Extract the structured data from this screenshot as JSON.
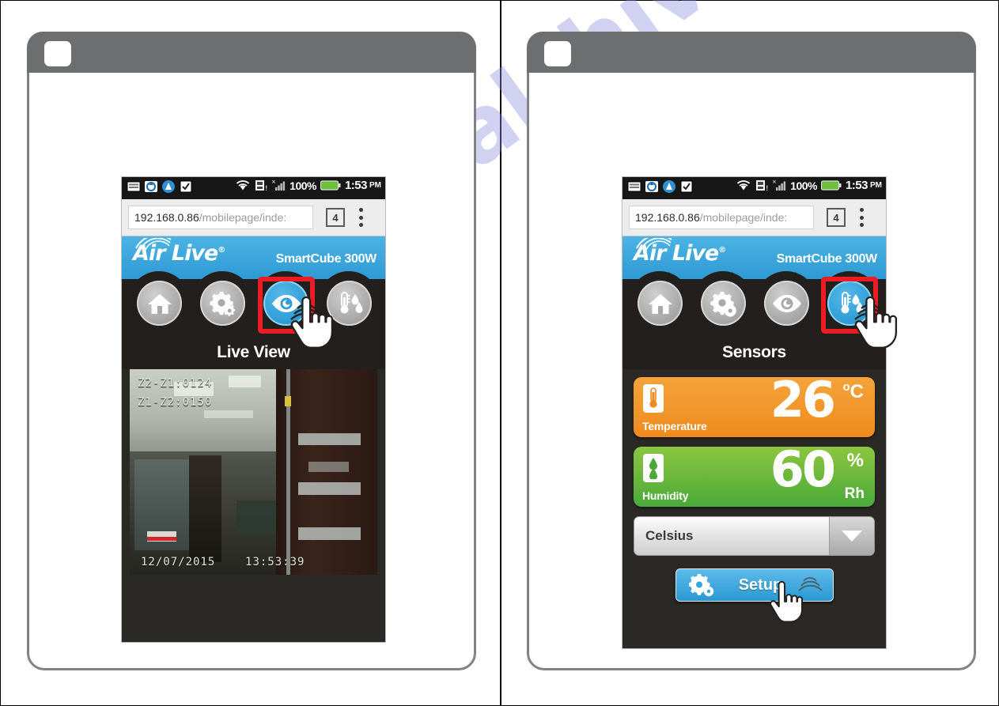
{
  "watermark": {
    "text": "manualshive.com"
  },
  "panels": [
    {
      "id": "left",
      "status_bar": {
        "icons": [
          "keyboard-icon",
          "sync-icon",
          "app-icon",
          "clipboard-icon",
          "wifi-icon",
          "sd-card-icon",
          "signal-icon"
        ],
        "battery_percent": "100%",
        "time": "1:53",
        "ampm": "PM"
      },
      "browser": {
        "url_host": "192.168.0.86",
        "url_path": "/mobilepage/inde:",
        "tab_count": "4",
        "menu_icon": "kebab-menu-icon"
      },
      "brand": {
        "logo_text": "Air Live",
        "registered": "®",
        "model": "SmartCube 300W"
      },
      "nav": {
        "items": [
          {
            "icon": "home-icon",
            "label": "Home",
            "active": false
          },
          {
            "icon": "settings-gear-icon",
            "label": "Settings",
            "active": false
          },
          {
            "icon": "eye-icon",
            "label": "Live View",
            "active": true
          },
          {
            "icon": "thermometer-humidity-icon",
            "label": "Sensors",
            "active": false
          }
        ],
        "selected_label": "Live View"
      },
      "video": {
        "overlay_line1": "Z2-Z1:0124",
        "overlay_line2": "Z1-Z2:0150",
        "timestamp_date": "12/07/2015",
        "timestamp_time": "13:53:39"
      },
      "highlight": {
        "target": "eye-icon"
      },
      "hand_cursor": {
        "target": "eye-icon"
      }
    },
    {
      "id": "right",
      "status_bar": {
        "icons": [
          "keyboard-icon",
          "sync-icon",
          "app-icon",
          "clipboard-icon",
          "wifi-icon",
          "sd-card-icon",
          "signal-icon"
        ],
        "battery_percent": "100%",
        "time": "1:53",
        "ampm": "PM"
      },
      "browser": {
        "url_host": "192.168.0.86",
        "url_path": "/mobilepage/inde:",
        "tab_count": "4",
        "menu_icon": "kebab-menu-icon"
      },
      "brand": {
        "logo_text": "Air Live",
        "registered": "®",
        "model": "SmartCube 300W"
      },
      "nav": {
        "items": [
          {
            "icon": "home-icon",
            "label": "Home",
            "active": false
          },
          {
            "icon": "settings-gear-icon",
            "label": "Settings",
            "active": false
          },
          {
            "icon": "eye-icon",
            "label": "Live View",
            "active": false
          },
          {
            "icon": "thermometer-humidity-icon",
            "label": "Sensors",
            "active": true
          }
        ],
        "selected_label": "Sensors"
      },
      "sensors": [
        {
          "icon": "thermometer-icon",
          "name": "Temperature",
          "value": "26",
          "unit_primary": "C",
          "unit_degree": "o",
          "unit_secondary": "",
          "color": "#ef8b1e"
        },
        {
          "icon": "water-drop-icon",
          "name": "Humidity",
          "value": "60",
          "unit_primary": "%",
          "unit_degree": "",
          "unit_secondary": "Rh",
          "color": "#4aa93a"
        }
      ],
      "unit_select": {
        "value": "Celsius",
        "arrow_icon": "chevron-down-icon"
      },
      "setup_button": {
        "label": "Setup",
        "icon": "settings-gear-icon"
      },
      "highlight": {
        "target": "thermometer-humidity-icon"
      },
      "hand_cursor": {
        "target": "thermometer-humidity-icon"
      }
    }
  ],
  "colors": {
    "brand_blue": "#3BA7DD",
    "highlight_red": "#EC1C24",
    "temp_orange": "#EF8B1E",
    "humidity_green": "#4AA93A",
    "phone_body": "#2B2926",
    "frame_gray": "#6D6E70"
  }
}
